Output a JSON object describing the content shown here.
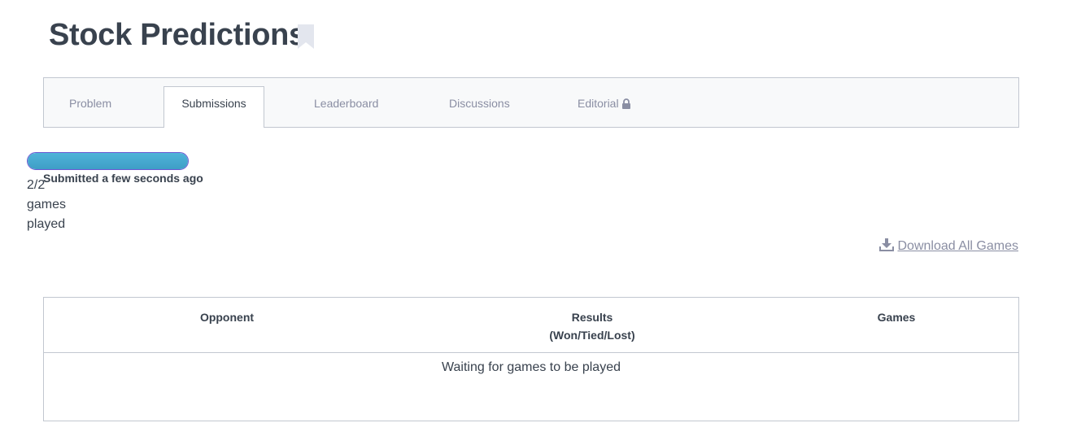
{
  "page": {
    "title": "Stock Predictions"
  },
  "tabs": [
    {
      "label": "Problem",
      "active": false
    },
    {
      "label": "Submissions",
      "active": true
    },
    {
      "label": "Leaderboard",
      "active": false
    },
    {
      "label": "Discussions",
      "active": false
    },
    {
      "label": "Editorial",
      "active": false,
      "icon": "lock-icon"
    }
  ],
  "submission": {
    "progress_fraction": 1.0,
    "games_played": "2/2 games played",
    "status": "Submitted a few seconds ago"
  },
  "download": {
    "label": "Download All Games",
    "icon": "download-icon"
  },
  "table": {
    "headers": {
      "opponent": "Opponent",
      "results": "Results",
      "results_sub": "(Won/Tied/Lost)",
      "games": "Games"
    },
    "empty_message": "Waiting for games to be played"
  },
  "colors": {
    "accent_purple": "#6b59d3",
    "progress_blue": "#4fb3d9",
    "text_dark": "#39424e",
    "text_muted": "#8a8ea3"
  }
}
